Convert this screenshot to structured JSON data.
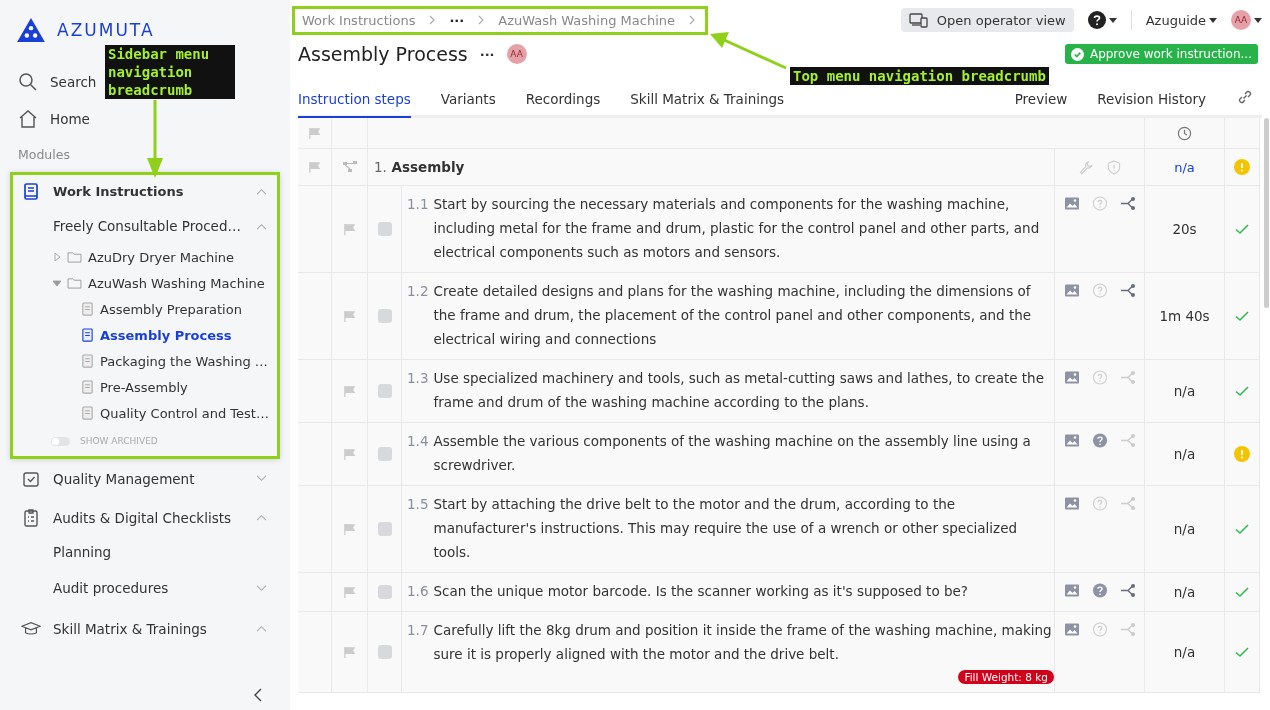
{
  "logo": {
    "text": "AZUMUTA"
  },
  "sidebar": {
    "top_items": [
      {
        "kind": "search",
        "label": "Search"
      },
      {
        "kind": "home",
        "label": "Home"
      }
    ],
    "section_label": "Modules",
    "modules": [
      {
        "kind": "book",
        "label": "Work Instructions",
        "expanded": true,
        "highlighted": true,
        "children": [
          {
            "label": "Freely Consultable Proced…",
            "expanded": true,
            "children": [
              {
                "label": "AzuDry Dryer Machine",
                "expanded": false
              },
              {
                "label": "AzuWash Washing Machine",
                "expanded": true,
                "docs": [
                  {
                    "label": "Assembly Preparation",
                    "selected": false
                  },
                  {
                    "label": "Assembly Process",
                    "selected": true
                  },
                  {
                    "label": "Packaging the Washing …",
                    "selected": false
                  },
                  {
                    "label": "Pre-Assembly",
                    "selected": false
                  },
                  {
                    "label": "Quality Control and Test…",
                    "selected": false
                  }
                ]
              }
            ]
          }
        ],
        "show_archived": {
          "label": "SHOW ARCHIVED",
          "on": false
        }
      },
      {
        "kind": "checkbox",
        "label": "Quality Management",
        "expanded": false
      },
      {
        "kind": "clipboard",
        "label": "Audits & Digital Checklists",
        "expanded": true,
        "subitems": [
          {
            "label": "Planning"
          },
          {
            "label": "Audit procedures",
            "expanded": false
          }
        ]
      },
      {
        "kind": "cap",
        "label": "Skill Matrix & Trainings",
        "expanded": true
      }
    ]
  },
  "breadcrumb": {
    "highlighted": true,
    "items": [
      "Work Instructions",
      "···",
      "AzuWash Washing Machine"
    ]
  },
  "header": {
    "operator_button": "Open operator view",
    "user": "Azuguide",
    "avatar": "AA",
    "title": "Assembly Process",
    "title_menu": "···",
    "title_avatar": "AA",
    "approve_button": "Approve work instruction..."
  },
  "tabs": [
    {
      "label": "Instruction steps",
      "selected": true
    },
    {
      "label": "Variants",
      "selected": false
    },
    {
      "label": "Recordings",
      "selected": false
    },
    {
      "label": "Skill Matrix & Trainings",
      "selected": false
    }
  ],
  "right_tabs": [
    {
      "label": "Preview"
    },
    {
      "label": "Revision History"
    }
  ],
  "group": {
    "number": "1.",
    "title": "Assembly",
    "time": "n/a",
    "warning": true
  },
  "steps": [
    {
      "number": "1.1",
      "text": "Start by sourcing the necessary materials and components for the washing machine, including metal for the frame and drum, plastic for the control panel and other parts, and electrical components such as motors and sensors.",
      "checked": false,
      "has_question": false,
      "linked": true,
      "time": "20s",
      "warning": false
    },
    {
      "number": "1.2",
      "text": "Create detailed designs and plans for the washing machine, including the dimensions of the frame and drum, the placement of the control panel and other components, and the electrical wiring and connections",
      "checked": false,
      "has_question": false,
      "linked": true,
      "time": "1m 40s",
      "warning": false
    },
    {
      "number": "1.3",
      "text": "Use specialized machinery and tools, such as metal-cutting saws and lathes, to create the frame and drum of the washing machine according to the plans.",
      "checked": false,
      "has_question": false,
      "linked": false,
      "time": "n/a",
      "warning": false
    },
    {
      "number": "1.4",
      "text": "Assemble the various components of the washing machine on the assembly line using a screwdriver.",
      "checked": false,
      "has_question": true,
      "linked": false,
      "time": "n/a",
      "warning": true
    },
    {
      "number": "1.5",
      "text": "Start by attaching the drive belt to the motor and the drum, according to the manufacturer's instructions. This may require the use of a wrench or other specialized tools.",
      "checked": false,
      "has_question": false,
      "linked": false,
      "time": "n/a",
      "warning": false
    },
    {
      "number": "1.6",
      "text": "Scan the unique motor barcode. Is the scanner working as it's supposed to be?",
      "checked": false,
      "has_question": true,
      "linked": true,
      "time": "n/a",
      "warning": false
    },
    {
      "number": "1.7",
      "text": "Carefully lift the 8kg drum and position it inside the frame of the washing machine, making sure it is properly aligned with the motor and the drive belt.",
      "checked": false,
      "has_question": false,
      "linked": false,
      "time": "n/a",
      "warning": false,
      "badge": "Fill Weight: 8 kg"
    }
  ],
  "annotations": [
    {
      "kind": "sidebar",
      "text": "Sidebar menu navigation breadcrumb"
    },
    {
      "kind": "top",
      "text": "Top menu navigation breadcrumb"
    }
  ]
}
